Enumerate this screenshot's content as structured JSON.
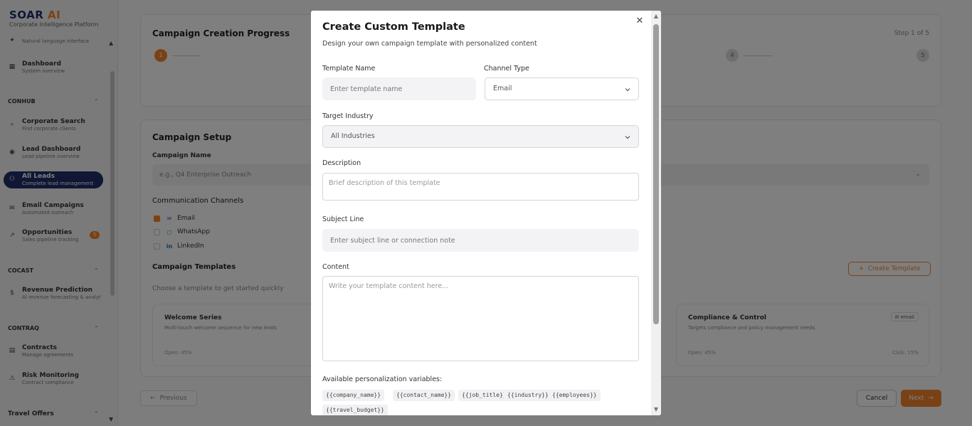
{
  "app": {
    "logo": "SOAR",
    "logo_ai": "AI",
    "tagline": "Corporate Intelligence Platform"
  },
  "sidebar": {
    "top_item_sub": "Natural language interface",
    "items": [
      {
        "title": "Dashboard",
        "sub": "System overview"
      },
      {
        "section": "CONHUB"
      },
      {
        "title": "Corporate Search",
        "sub": "Find corporate clients"
      },
      {
        "title": "Lead Dashboard",
        "sub": "Lead pipeline overview"
      },
      {
        "title": "All Leads",
        "sub": "Complete lead management"
      },
      {
        "title": "Email Campaigns",
        "sub": "Automated outreach"
      },
      {
        "title": "Opportunities",
        "sub": "Sales pipeline tracking",
        "badge": "5"
      },
      {
        "section": "COCAST"
      },
      {
        "title": "Revenue Prediction",
        "sub": "AI revenue forecasting & analytics"
      },
      {
        "section": "CONTRAQ"
      },
      {
        "title": "Contracts",
        "sub": "Manage agreements"
      },
      {
        "title": "Risk Monitoring",
        "sub": "Contract compliance"
      },
      {
        "section": "Travel Offers"
      }
    ]
  },
  "main": {
    "progress": {
      "title": "Campaign Creation Progress",
      "step_label": "Step 1 of 5",
      "steps": [
        "1",
        "4",
        "5"
      ]
    },
    "setup": {
      "title": "Campaign Setup",
      "name_label": "Campaign Name",
      "name_placeholder": "e.g., Q4 Enterprise Outreach",
      "channels_title": "Communication Channels",
      "channels": [
        "Email",
        "WhatsApp",
        "LinkedIn"
      ],
      "templates_title": "Campaign Templates",
      "templates_sub": "Choose a template to get started quickly",
      "create_template": "Create Template",
      "cards": [
        {
          "title": "Welcome Series",
          "desc": "Multi-touch welcome sequence for new leads",
          "meta_left": "Open: 45%"
        },
        {
          "title": "Compliance & Control",
          "desc": "Targets compliance and policy management needs",
          "tag": "email",
          "meta_left": "Open: 45%",
          "meta_right": "Click: 15%"
        }
      ]
    },
    "footer": {
      "previous": "Previous",
      "cancel": "Cancel",
      "next": "Next"
    }
  },
  "modal": {
    "title": "Create Custom Template",
    "subtitle": "Design your own campaign template with personalized content",
    "template_name_label": "Template Name",
    "template_name_placeholder": "Enter template name",
    "channel_type_label": "Channel Type",
    "channel_type_value": "Email",
    "target_industry_label": "Target Industry",
    "target_industry_value": "All Industries",
    "description_label": "Description",
    "description_placeholder": "Brief description of this template",
    "subject_label": "Subject Line",
    "subject_placeholder": "Enter subject line or connection note",
    "content_label": "Content",
    "content_placeholder": "Write your template content here...",
    "variables_label": "Available personalization variables:",
    "variables": [
      "{{company_name}}",
      "{{contact_name}}",
      "{{job_title}}",
      "{{industry}}",
      "{{employees}}",
      "{{travel_budget}}"
    ]
  },
  "colors": {
    "accent": "#f2842c",
    "brand": "#1e2f6b",
    "overlay": "rgba(0,0,0,0.5)"
  }
}
